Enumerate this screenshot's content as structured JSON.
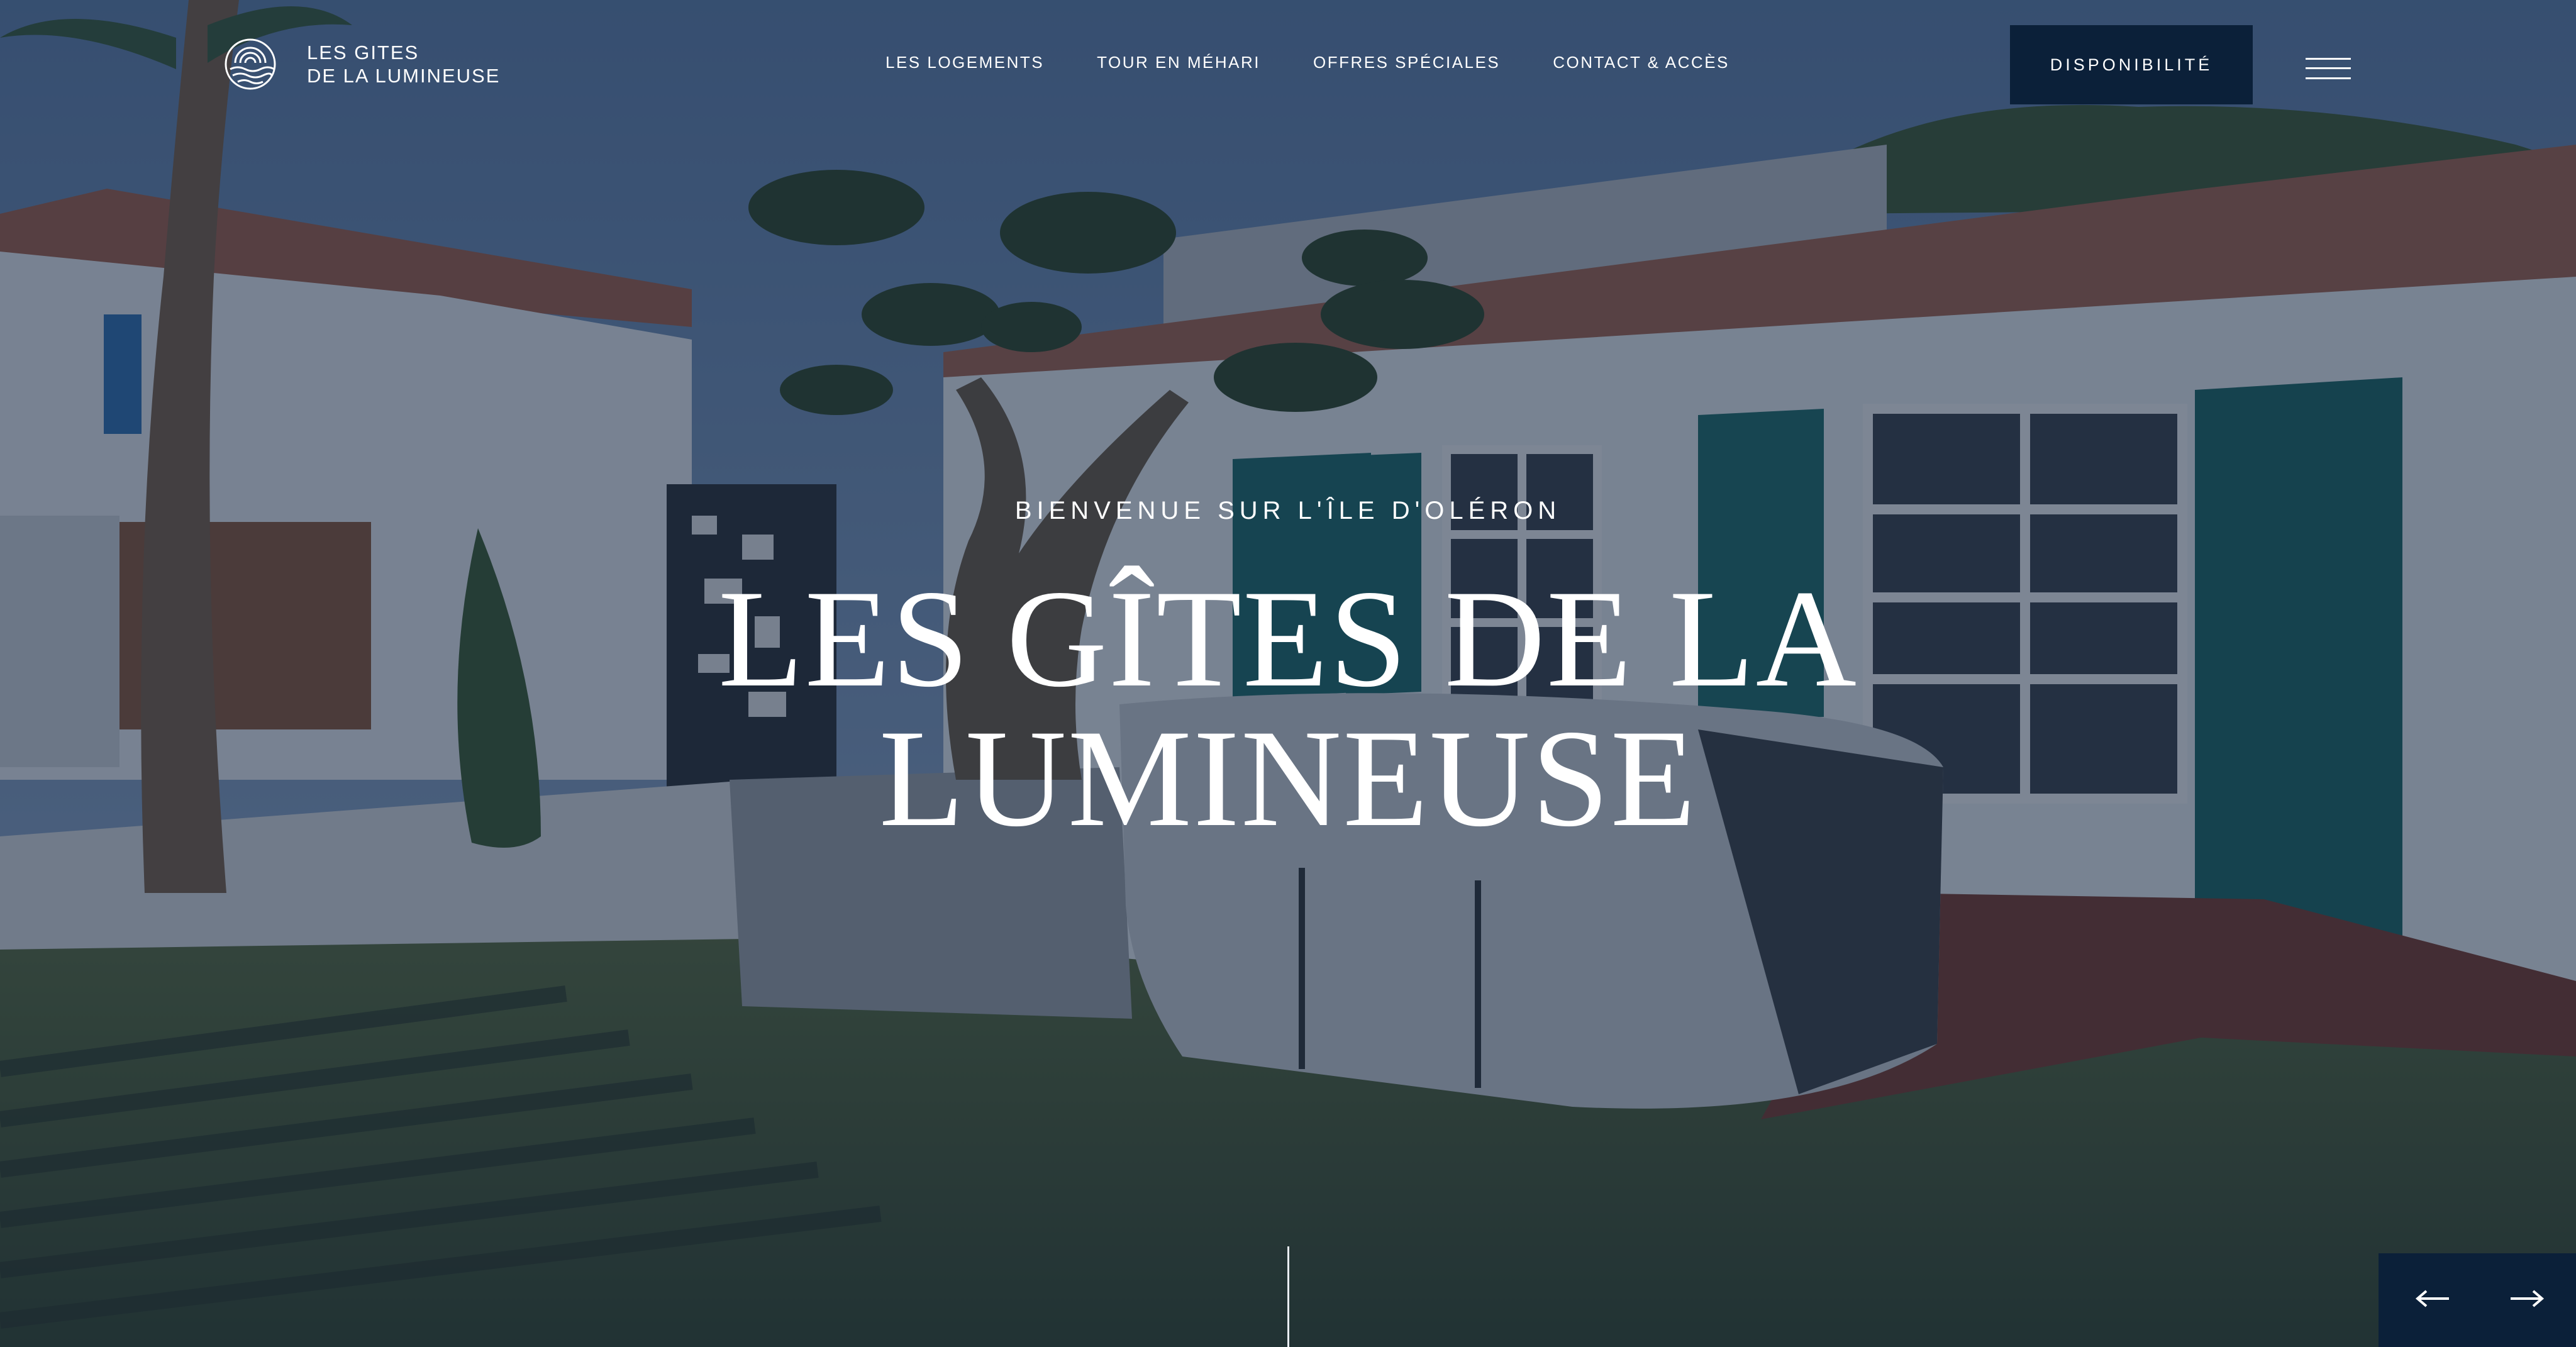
{
  "brand": {
    "line1": "LES GITES",
    "line2": "DE LA LUMINEUSE",
    "logo_icon": "sun-over-waves-icon"
  },
  "nav": {
    "items": [
      {
        "label": "LES LOGEMENTS"
      },
      {
        "label": "TOUR EN MÉHARI"
      },
      {
        "label": "OFFRES SPÉCIALES"
      },
      {
        "label": "CONTACT & ACCÈS"
      }
    ]
  },
  "cta": {
    "label": "DISPONIBILITÉ"
  },
  "menu": {
    "icon": "hamburger-menu-icon"
  },
  "hero": {
    "kicker": "BIENVENUE SUR L'ÎLE D'OLÉRON",
    "title_line1": "LES GÎTES DE LA",
    "title_line2": "LUMINEUSE",
    "background_image": "garden with covered hot tub, olive tree and white house with green shutters"
  },
  "slider": {
    "prev_icon": "arrow-left-icon",
    "next_icon": "arrow-right-icon"
  },
  "colors": {
    "navy": "#0b2039",
    "overlay": "#12223e",
    "text": "#ffffff"
  }
}
